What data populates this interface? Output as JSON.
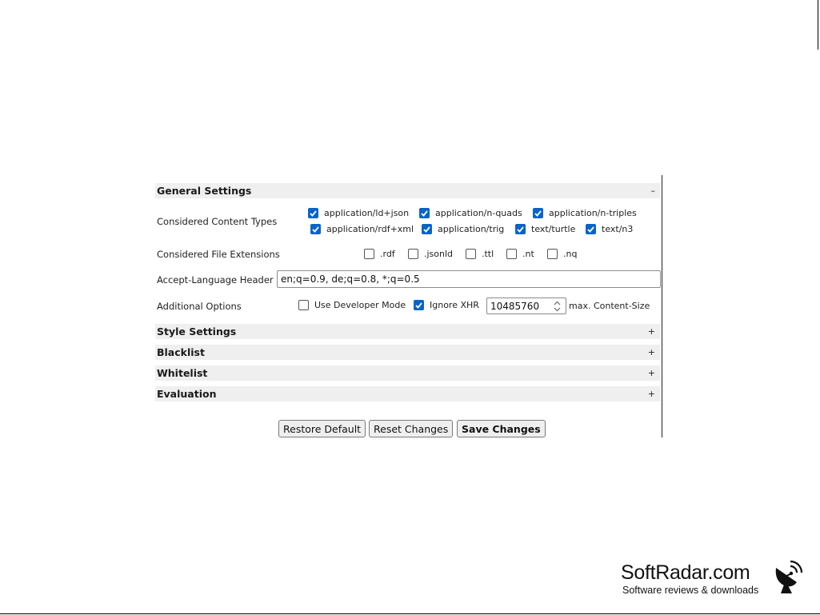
{
  "sections": {
    "general": {
      "title": "General Settings",
      "toggle": "–"
    },
    "style": {
      "title": "Style Settings",
      "toggle": "+"
    },
    "blacklist": {
      "title": "Blacklist",
      "toggle": "+"
    },
    "whitelist": {
      "title": "Whitelist",
      "toggle": "+"
    },
    "evaluation": {
      "title": "Evaluation",
      "toggle": "+"
    }
  },
  "content_types": {
    "label": "Considered Content Types",
    "items": [
      {
        "label": "application/ld+json",
        "checked": true
      },
      {
        "label": "application/n-quads",
        "checked": true
      },
      {
        "label": "application/n-triples",
        "checked": true
      },
      {
        "label": "application/rdf+xml",
        "checked": true
      },
      {
        "label": "application/trig",
        "checked": true
      },
      {
        "label": "text/turtle",
        "checked": true
      },
      {
        "label": "text/n3",
        "checked": true
      }
    ]
  },
  "file_extensions": {
    "label": "Considered File Extensions",
    "items": [
      {
        "label": ".rdf",
        "checked": false
      },
      {
        "label": ".jsonld",
        "checked": false
      },
      {
        "label": ".ttl",
        "checked": false
      },
      {
        "label": ".nt",
        "checked": false
      },
      {
        "label": ".nq",
        "checked": false
      }
    ]
  },
  "accept_language": {
    "label": "Accept-Language Header",
    "value": "en;q=0.9, de;q=0.8, *;q=0.5"
  },
  "additional_options": {
    "label": "Additional Options",
    "developer_mode": {
      "label": "Use Developer Mode",
      "checked": false
    },
    "ignore_xhr": {
      "label": "Ignore XHR",
      "checked": true
    },
    "max_content_size": {
      "value": "10485760",
      "label": "max. Content-Size"
    }
  },
  "buttons": {
    "restore": "Restore Default",
    "reset": "Reset Changes",
    "save": "Save Changes"
  },
  "watermark": {
    "name": "SoftRadar.com",
    "tagline": "Software reviews & downloads",
    "icon": "satellite-dish-icon"
  },
  "colors": {
    "checkbox_checked": "#0a64c8",
    "section_header_bg": "#efefef"
  }
}
